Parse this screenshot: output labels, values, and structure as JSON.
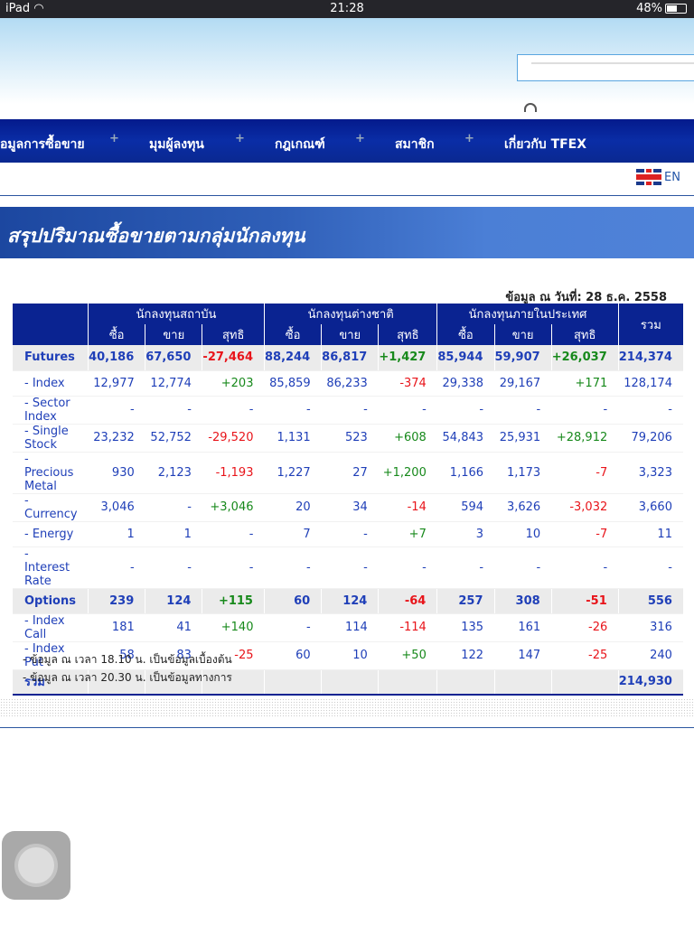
{
  "status": {
    "device": "iPad",
    "time": "21:28",
    "battery": "48%",
    "battery_level": 0.48
  },
  "nav": {
    "items": [
      "อมูลการซื้อขาย",
      "มุมผู้ลงทุน",
      "กฎเกณฑ์",
      "สมาชิก",
      "เกี่ยวกับ TFEX"
    ],
    "separator": "+"
  },
  "lang": {
    "label": "EN"
  },
  "banner": {
    "title": "สรุปปริมาณซื้อขายตามกลุ่มนักลงทุน"
  },
  "asof": "ข้อมูล ณ วันที่: 28 ธ.ค. 2558",
  "table": {
    "groups": [
      "นักลงทุนสถาบัน",
      "นักลงทุนต่างชาติ",
      "นักลงทุนภายในประเทศ"
    ],
    "total_header": "รวม",
    "sub": [
      "ซื้อ",
      "ขาย",
      "สุทธิ"
    ],
    "rows": [
      {
        "label": "Futures",
        "summary": true,
        "cells": [
          "40,186",
          "67,650",
          "-27,464",
          "88,244",
          "86,817",
          "+1,427",
          "85,944",
          "59,907",
          "+26,037",
          "214,374"
        ]
      },
      {
        "label": "- Index",
        "cells": [
          "12,977",
          "12,774",
          "+203",
          "85,859",
          "86,233",
          "-374",
          "29,338",
          "29,167",
          "+171",
          "128,174"
        ]
      },
      {
        "label": "- Sector Index",
        "cells": [
          "-",
          "-",
          "-",
          "-",
          "-",
          "-",
          "-",
          "-",
          "-",
          "-"
        ]
      },
      {
        "label": "- Single Stock",
        "cells": [
          "23,232",
          "52,752",
          "-29,520",
          "1,131",
          "523",
          "+608",
          "54,843",
          "25,931",
          "+28,912",
          "79,206"
        ]
      },
      {
        "label": "- Precious Metal",
        "cells": [
          "930",
          "2,123",
          "-1,193",
          "1,227",
          "27",
          "+1,200",
          "1,166",
          "1,173",
          "-7",
          "3,323"
        ]
      },
      {
        "label": "- Currency",
        "cells": [
          "3,046",
          "-",
          "+3,046",
          "20",
          "34",
          "-14",
          "594",
          "3,626",
          "-3,032",
          "3,660"
        ]
      },
      {
        "label": "- Energy",
        "cells": [
          "1",
          "1",
          "-",
          "7",
          "-",
          "+7",
          "3",
          "10",
          "-7",
          "11"
        ]
      },
      {
        "label": "- Interest Rate",
        "cells": [
          "-",
          "-",
          "-",
          "-",
          "-",
          "-",
          "-",
          "-",
          "-",
          "-"
        ]
      },
      {
        "label": "Options",
        "summary": true,
        "cells": [
          "239",
          "124",
          "+115",
          "60",
          "124",
          "-64",
          "257",
          "308",
          "-51",
          "556"
        ]
      },
      {
        "label": "- Index Call",
        "cells": [
          "181",
          "41",
          "+140",
          "-",
          "114",
          "-114",
          "135",
          "161",
          "-26",
          "316"
        ]
      },
      {
        "label": "- Index Put",
        "cells": [
          "58",
          "83",
          "-25",
          "60",
          "10",
          "+50",
          "122",
          "147",
          "-25",
          "240"
        ]
      },
      {
        "label": "รวม",
        "summary": true,
        "total": true,
        "cells": [
          "",
          "",
          "",
          "",
          "",
          "",
          "",
          "",
          "",
          "214,930"
        ]
      }
    ]
  },
  "notes": [
    "- ข้อมูล ณ เวลา 18.10 น. เป็นข้อมูลเบื้องต้น",
    "- ข้อมูล ณ เวลา 20.30 น. เป็นข้อมูลทางการ"
  ],
  "colors": {
    "nav": "#0a2391",
    "value": "#1f3fb8",
    "positive": "#17891b",
    "negative": "#e8141a"
  }
}
